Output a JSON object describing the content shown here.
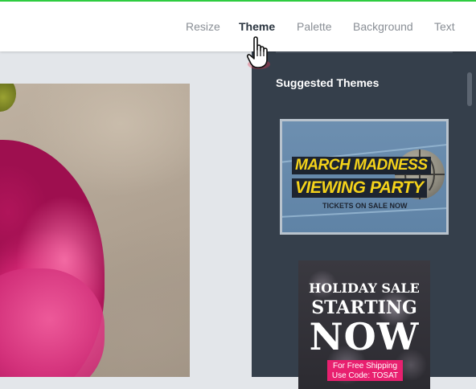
{
  "tabs": [
    {
      "label": "Resize",
      "active": false
    },
    {
      "label": "Theme",
      "active": true
    },
    {
      "label": "Palette",
      "active": false
    },
    {
      "label": "Background",
      "active": false
    },
    {
      "label": "Text",
      "active": false
    }
  ],
  "sidebar": {
    "title": "Suggested Themes",
    "themes": [
      {
        "line1": "MARCH MADNESS",
        "line2": "VIEWING PARTY",
        "sub": "TICKETS ON SALE NOW"
      },
      {
        "line1": "HOLIDAY SALE",
        "line2": "STARTING",
        "line3": "NOW",
        "promo1": "For Free Shipping",
        "promo2": "Use Code: TOSAT"
      }
    ]
  },
  "colors": {
    "accent_green": "#2ecc40",
    "sidebar_bg": "#353f4b",
    "highlight_yellow": "#f4d21a",
    "promo_pink": "#e8206f"
  },
  "icons": {
    "pointer": "hand-pointer-cursor-icon"
  }
}
